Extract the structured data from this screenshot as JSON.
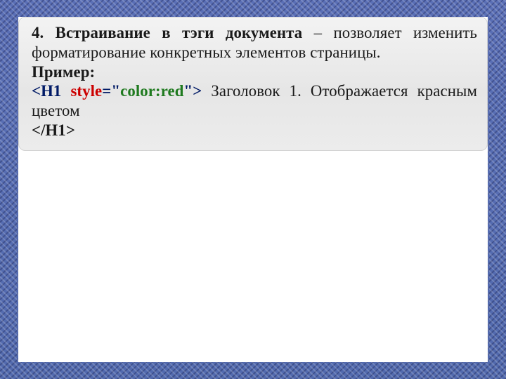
{
  "title_bold": "4. Встраивание в тэги документа",
  "title_rest": " – позволяет изменить форматирование конкретных элементов страницы.",
  "label_example": "Пример:",
  "code_open_lt": "<",
  "code_tag_open": "H1 ",
  "code_attr": "style",
  "code_eq_q": "=\"",
  "code_value": "color:red",
  "code_q_gt": "\">",
  "code_text": " Заголовок 1. Отображается красным цветом",
  "code_close": "</H1>"
}
